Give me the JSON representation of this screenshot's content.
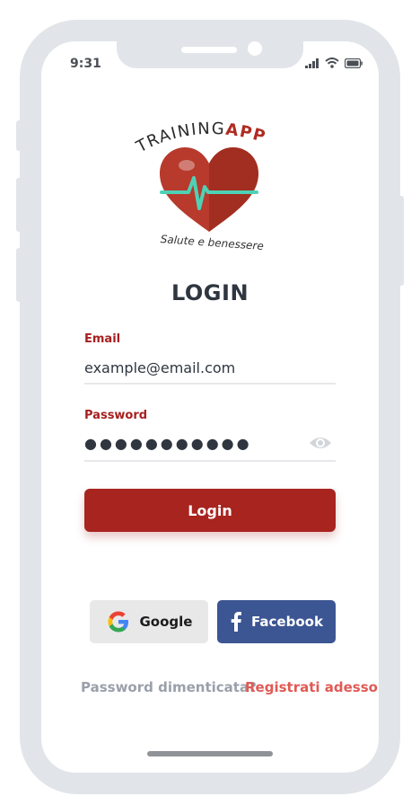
{
  "status_bar": {
    "time": "9:31"
  },
  "logo": {
    "brand_training": "TRAINING",
    "brand_app": "APP",
    "tagline": "Salute e benessere"
  },
  "screen": {
    "title": "LOGIN"
  },
  "email": {
    "label": "Email",
    "value": "example@email.com"
  },
  "password": {
    "label": "Password",
    "value": "●●●●●●●●●●●"
  },
  "login_button": {
    "label": "Login"
  },
  "social": {
    "google_label": "Google",
    "facebook_label": "Facebook"
  },
  "links": {
    "forgot_password": "Password dimenticata?",
    "register": "Registrati adesso"
  },
  "colors": {
    "accent": "#a8241f",
    "label_red": "#a61f1f",
    "facebook_blue": "#3c5593",
    "link_red": "#e05a55",
    "heart_red": "#b73a2c",
    "pulse_teal": "#4fd1b5"
  }
}
